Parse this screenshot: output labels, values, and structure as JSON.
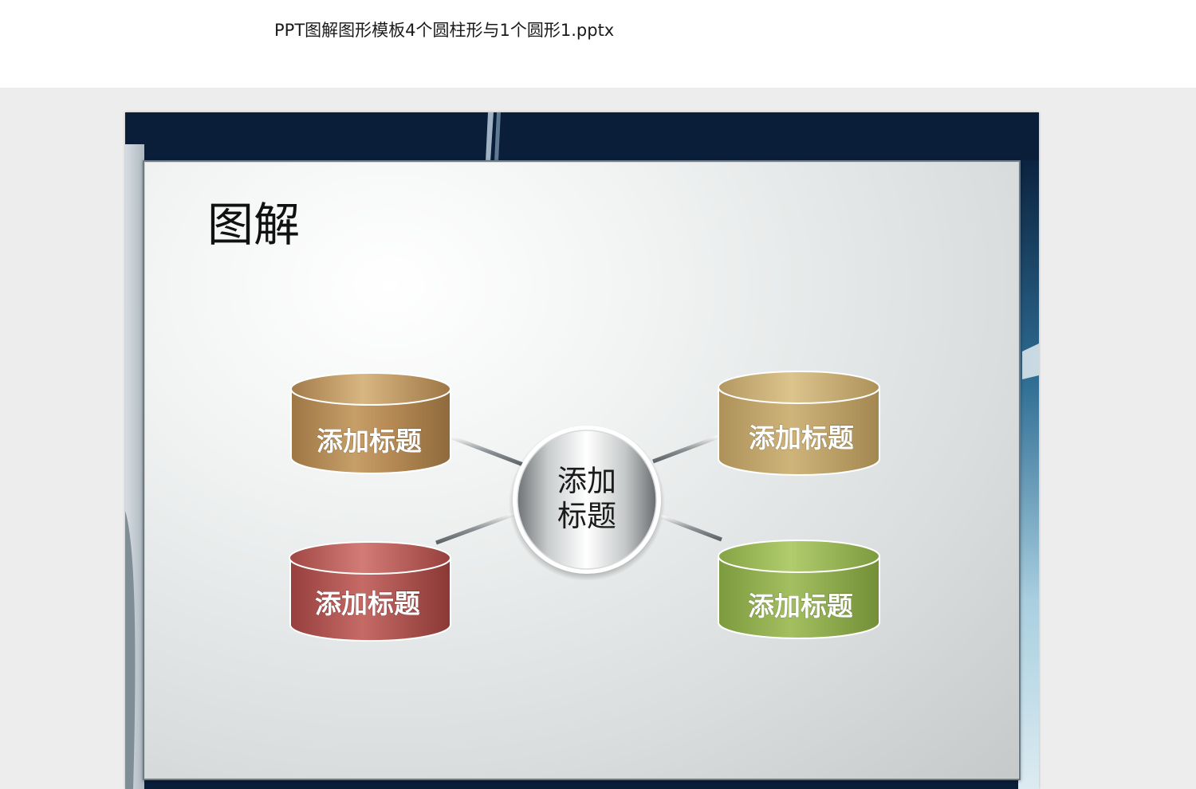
{
  "document": {
    "filename": "PPT图解图形模板4个圆柱形与1个圆形1.pptx"
  },
  "slide": {
    "heading": "图解",
    "hub": {
      "line1": "添加",
      "line2": "标题"
    },
    "cylinders": [
      {
        "id": "top-left",
        "label": "添加标题",
        "color": "#b68a55"
      },
      {
        "id": "top-right",
        "label": "添加标题",
        "color": "#bfa36a"
      },
      {
        "id": "bottom-left",
        "label": "添加标题",
        "color": "#b4524f"
      },
      {
        "id": "bottom-right",
        "label": "添加标题",
        "color": "#8fae4e"
      }
    ]
  },
  "colors": {
    "slide_frame": "#0a1e3a",
    "panel_border": "#6f7a80"
  }
}
